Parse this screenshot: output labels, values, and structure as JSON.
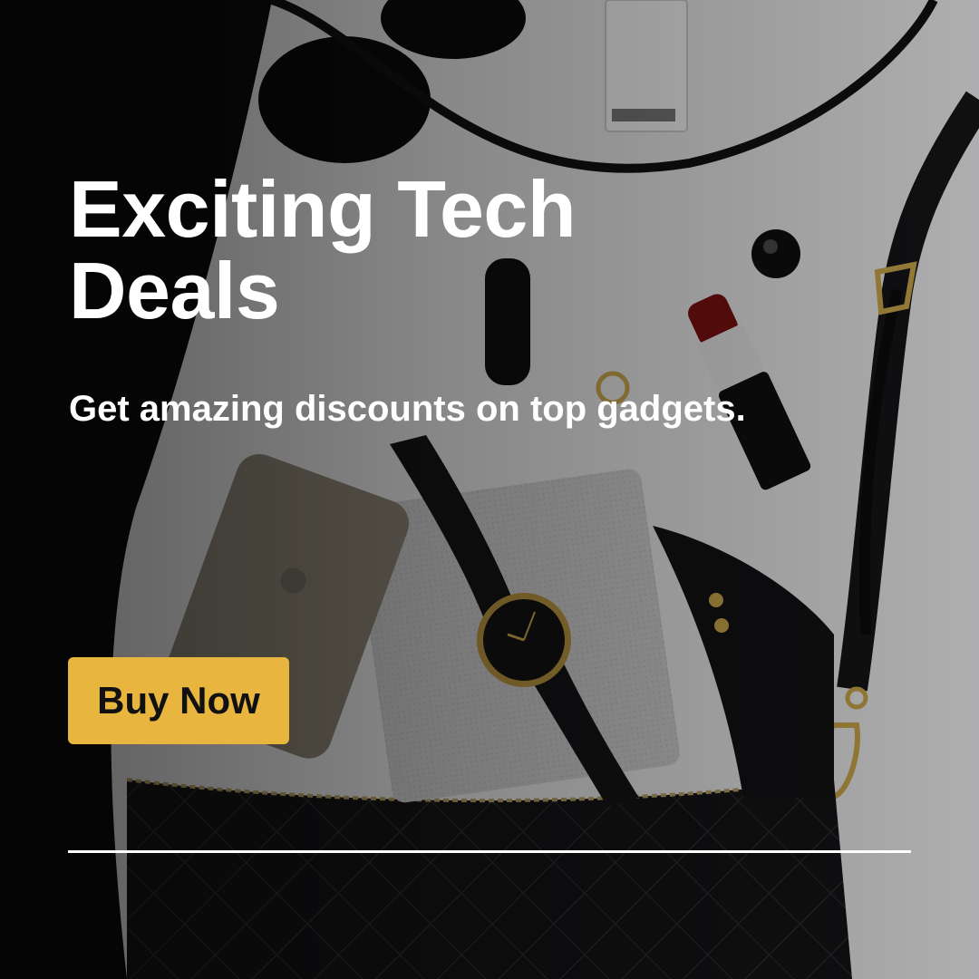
{
  "banner": {
    "headline": "Exciting Tech Deals",
    "subheadline": "Get amazing discounts on top gadgets.",
    "cta_label": "Buy Now"
  },
  "colors": {
    "cta_background": "#E8B63F",
    "text": "#FFFFFF",
    "divider": "#FFFFFF"
  }
}
